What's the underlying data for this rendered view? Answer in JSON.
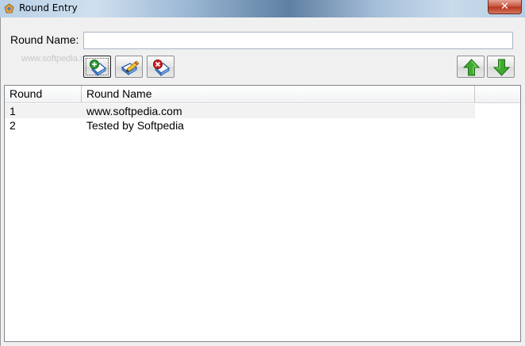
{
  "window": {
    "title": "Round Entry",
    "close_glyph": "✕"
  },
  "form": {
    "name_label": "Round Name:",
    "name_value": "",
    "watermark": "www.softpedia.com"
  },
  "toolbar": {
    "buttons": [
      {
        "icon": "add-book-icon"
      },
      {
        "icon": "edit-book-icon"
      },
      {
        "icon": "delete-book-icon"
      },
      {
        "icon": "move-up-arrow-icon"
      },
      {
        "icon": "move-down-arrow-icon"
      }
    ]
  },
  "table": {
    "columns": [
      "Round",
      "Round Name"
    ],
    "rows": [
      {
        "round": "1",
        "name": "www.softpedia.com"
      },
      {
        "round": "2",
        "name": "Tested by Softpedia"
      }
    ]
  },
  "colors": {
    "arrow_green": "#3faa2f",
    "delete_red": "#d11f1f",
    "add_green": "#2c9b35"
  }
}
